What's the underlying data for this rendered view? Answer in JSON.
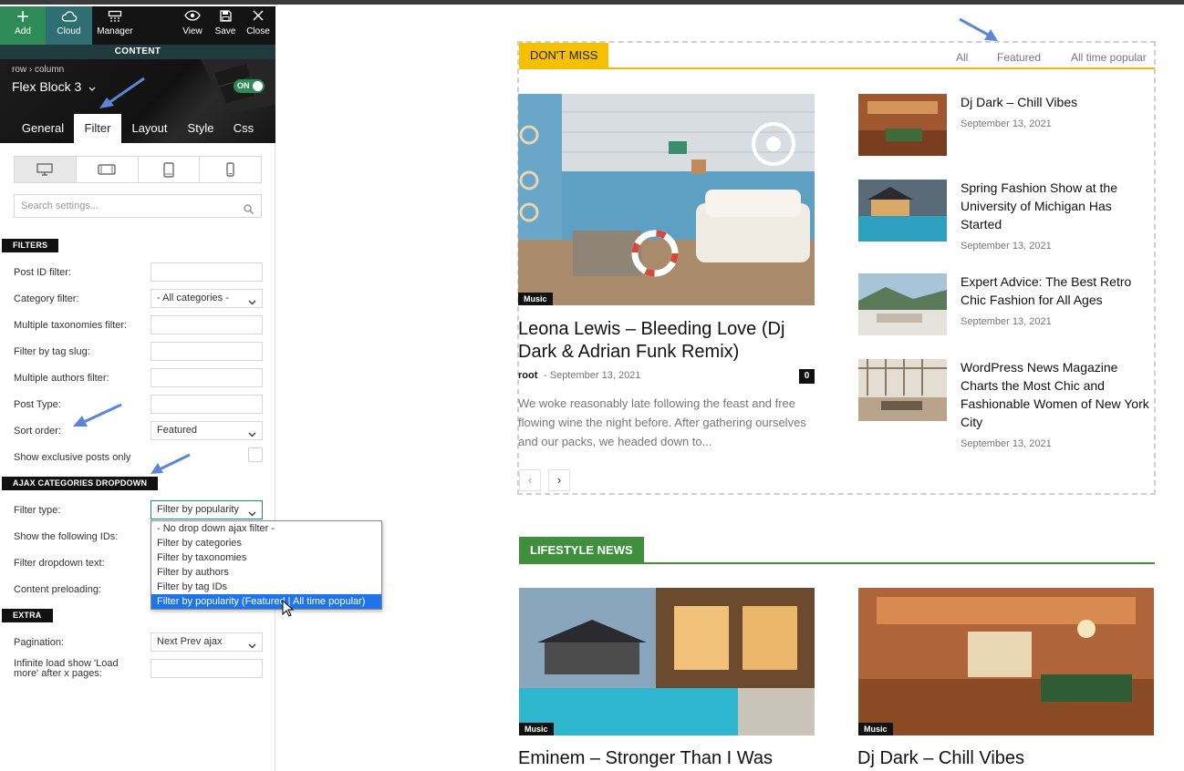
{
  "toolbar": {
    "add_label": "Add",
    "cloud_label": "Cloud",
    "manager_label": "Manager",
    "view_label": "View",
    "save_label": "Save",
    "close_label": "Close"
  },
  "panel": {
    "section_bar": "CONTENT",
    "breadcrumb": "row › column",
    "block_name": "Flex Block 3",
    "toggle_label": "ON",
    "tabs": [
      "General",
      "Filter",
      "Layout",
      "Style",
      "Css"
    ],
    "active_tab": "Filter",
    "search_placeholder": "Search settings...",
    "filters_section": "FILTERS",
    "ajax_section": "AJAX CATEGORIES DROPDOWN",
    "extra_section": "EXTRA",
    "fields": {
      "post_id": "Post ID filter:",
      "category": "Category filter:",
      "category_value": "- All categories -",
      "multi_tax": "Multiple taxonomies filter:",
      "tag_slug": "Filter by tag slug:",
      "multi_authors": "Multiple authors filter:",
      "post_type": "Post Type:",
      "sort_order": "Sort order:",
      "sort_order_value": "Featured",
      "exclusive": "Show exclusive posts only",
      "filter_type": "Filter type:",
      "filter_type_value": "Filter by popularity",
      "show_ids": "Show the following IDs:",
      "dropdown_text": "Filter dropdown text:",
      "preloading": "Content preloading:",
      "pagination": "Pagination:",
      "pagination_value": "Next Prev ajax",
      "infinite_load": "Infinite load show 'Load more' after x pages:"
    },
    "filter_type_options": [
      "- No drop down ajax filter -",
      "Filter by categories",
      "Filter by taxonomies",
      "Filter by authors",
      "Filter by tag IDs",
      "Filter by popularity (Featured | All time popular)"
    ],
    "filter_type_selected_index": 5
  },
  "preview": {
    "dont_miss": {
      "label": "DON'T MISS",
      "filters": [
        "All",
        "Featured",
        "All time popular"
      ],
      "main": {
        "category": "Music",
        "title": "Leona Lewis – Bleeding Love (Dj Dark & Adrian Funk Remix)",
        "author": "root",
        "date": "September 13, 2021",
        "comments": "0",
        "excerpt": "We woke reasonably late following the feast and free flowing wine the night before. After gathering ourselves and our packs, we headed down to..."
      },
      "side": [
        {
          "title": "Dj Dark – Chill Vibes",
          "date": "September 13, 2021"
        },
        {
          "title": "Spring Fashion Show at the University of Michigan Has Started",
          "date": "September 13, 2021"
        },
        {
          "title": "Expert Advice: The Best Retro Chic Fashion for All Ages",
          "date": "September 13, 2021"
        },
        {
          "title": "WordPress News Magazine Charts the Most Chic and Fashionable Women of New York City",
          "date": "September 13, 2021"
        }
      ],
      "pager_prev": "‹",
      "pager_next": "›"
    },
    "lifestyle": {
      "label": "LIFESTYLE NEWS",
      "cards": [
        {
          "category": "Music",
          "title": "Eminem – Stronger Than I Was"
        },
        {
          "category": "Music",
          "title": "Dj Dark – Chill Vibes"
        }
      ]
    }
  },
  "colors": {
    "accent_yellow": "#f5c000",
    "accent_green": "#3f8f3f",
    "toolbar_green": "#2e8b57",
    "highlight_blue": "#1e74e8",
    "annotation_arrow": "#5b86d6"
  },
  "icons": [
    "plus-icon",
    "cloud-icon",
    "manager-icon",
    "eye-icon",
    "save-icon",
    "close-icon",
    "desktop-icon",
    "tablet-landscape-icon",
    "tablet-portrait-icon",
    "phone-icon",
    "search-icon",
    "chevron-down-icon",
    "mouse-cursor-icon",
    "annotation-arrow"
  ]
}
